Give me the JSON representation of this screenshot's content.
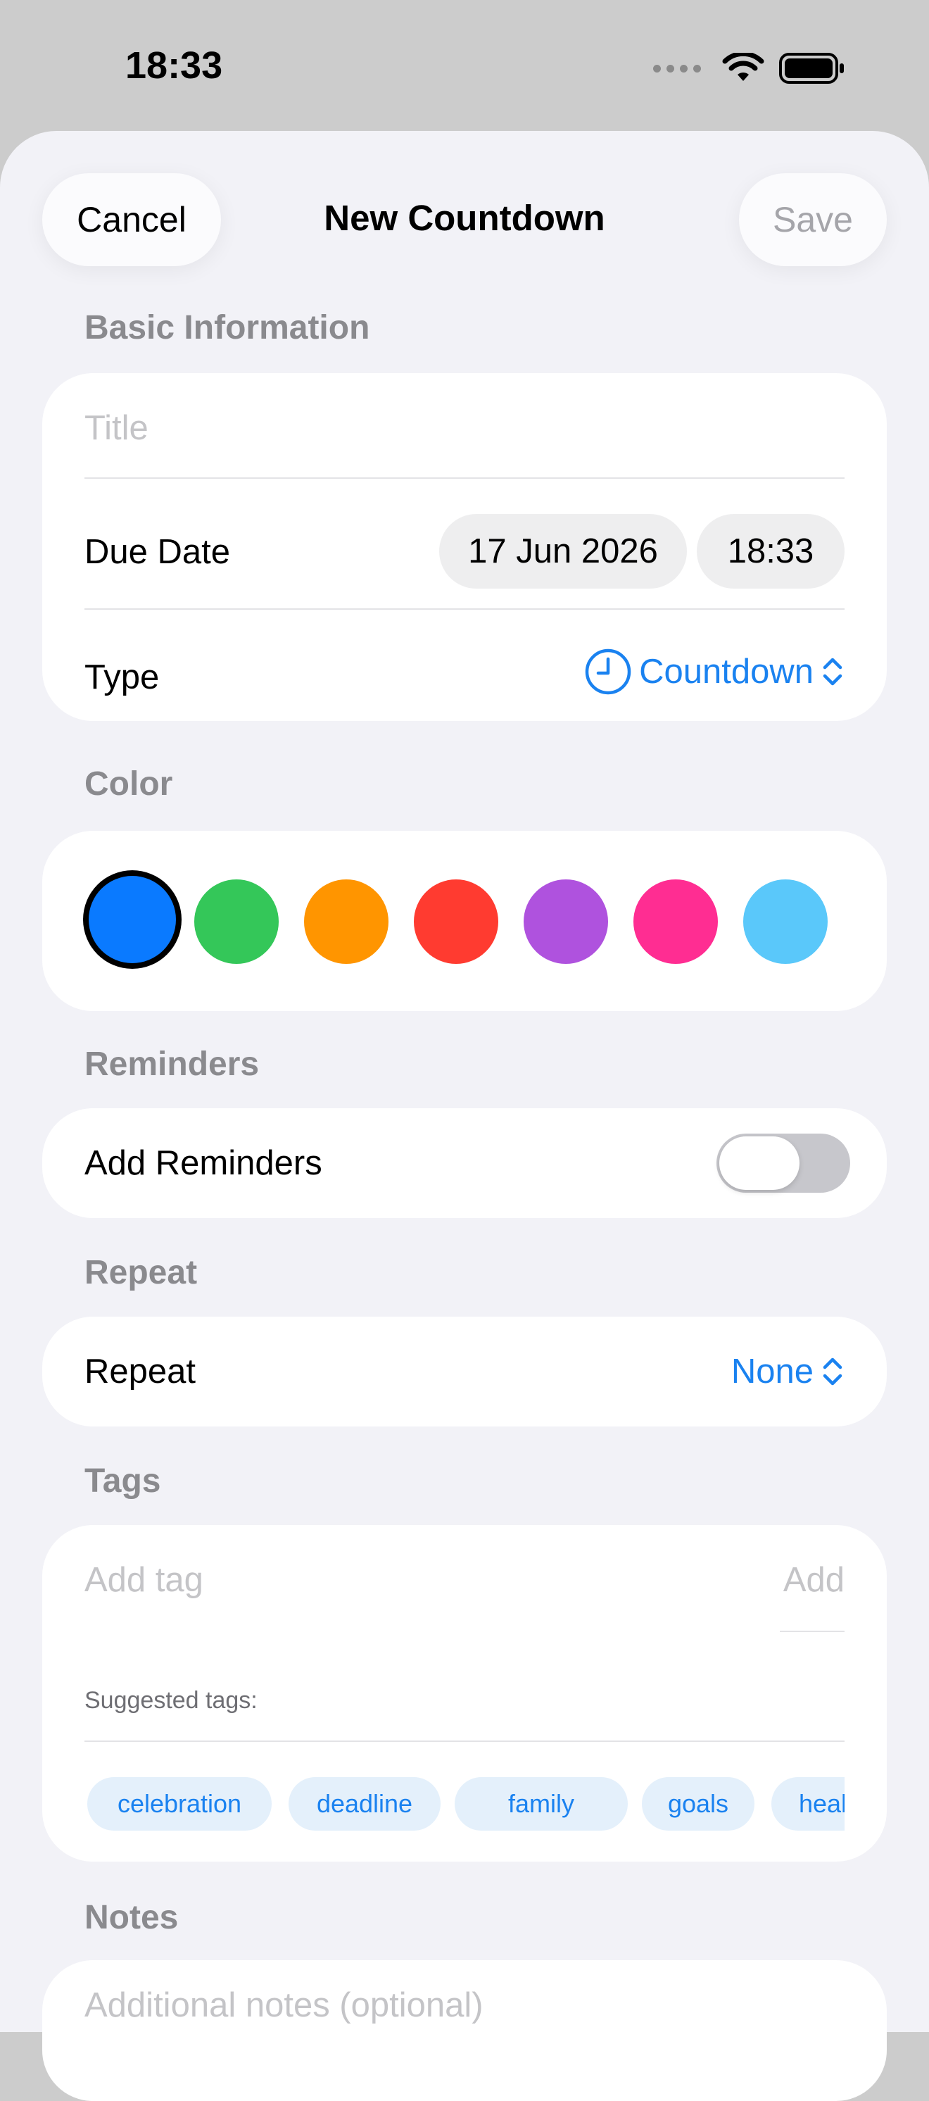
{
  "status_bar": {
    "time": "18:33"
  },
  "nav": {
    "cancel_label": "Cancel",
    "title": "New Countdown",
    "save_label": "Save"
  },
  "basic_info": {
    "header": "Basic Information",
    "title_placeholder": "Title",
    "due_date_label": "Due Date",
    "date_value": "17 Jun 2026",
    "time_value": "18:33",
    "type_label": "Type",
    "type_value": "Countdown",
    "type_icon": "clock-icon"
  },
  "color": {
    "header": "Color",
    "swatches": [
      "#0a7aff",
      "#34c759",
      "#ff9500",
      "#ff3b30",
      "#af52de",
      "#ff2d92",
      "#5ac8fa"
    ],
    "selected_index": 0
  },
  "reminders": {
    "header": "Reminders",
    "toggle_label": "Add Reminders",
    "enabled": false
  },
  "repeat": {
    "header": "Repeat",
    "label": "Repeat",
    "value": "None"
  },
  "tags": {
    "header": "Tags",
    "input_placeholder": "Add tag",
    "add_label": "Add",
    "suggested_label": "Suggested tags:",
    "suggested": [
      "celebration",
      "deadline",
      "family",
      "goals",
      "health"
    ]
  },
  "notes": {
    "header": "Notes",
    "placeholder": "Additional notes (optional)"
  }
}
